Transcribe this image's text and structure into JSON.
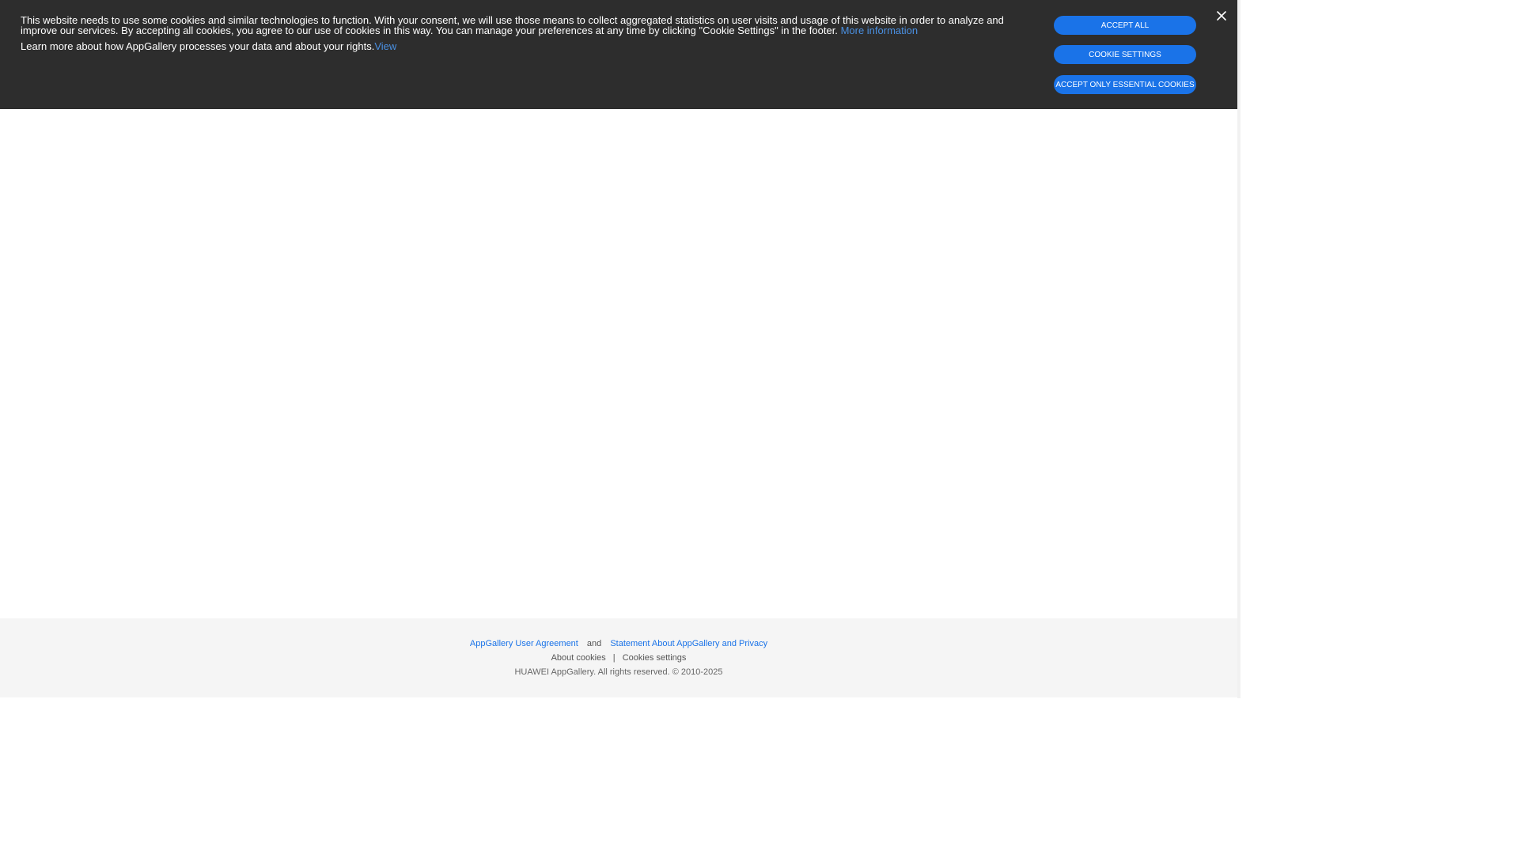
{
  "cookie_banner": {
    "text_line1": "This website needs to use some cookies and similar technologies to function. With your consent, we will use those means to collect aggregated statistics on user visits and usage of this website in order to analyze and improve our services. By accepting all cookies, you agree to our use of cookies in this way. You can manage your preferences at any time by clicking \"Cookie Settings\" in the footer.",
    "more_info_link": "More information",
    "text_line2": "Learn more about how AppGallery processes your data and about your rights.",
    "view_link": "View",
    "buttons": {
      "accept_all": "ACCEPT ALL",
      "cookie_settings": "COOKIE SETTINGS",
      "accept_essential": "ACCEPT ONLY ESSENTIAL COOKIES"
    },
    "close_icon": "close-icon"
  },
  "footer": {
    "user_agreement": "AppGallery User Agreement",
    "and": "and",
    "privacy_statement": "Statement About AppGallery and Privacy",
    "about_cookies": "About cookies",
    "separator": "|",
    "cookies_settings": "Cookies settings",
    "copyright": "HUAWEI AppGallery. All rights reserved. © 2010-2025"
  },
  "colors": {
    "banner_bg": "#2d2d2d",
    "accent": "#1a73e8",
    "link": "#4a90e2",
    "footer_bg": "#f5f5f5"
  }
}
